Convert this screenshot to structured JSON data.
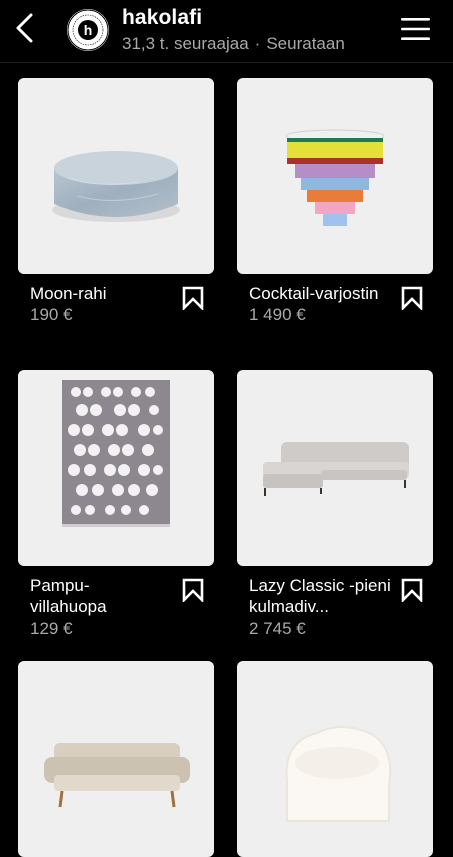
{
  "header": {
    "account_name": "hakolafi",
    "followers": "31,3 t. seuraajaa",
    "separator": "·",
    "follow_state": "Seurataan",
    "avatar_letter": "h",
    "avatar_ring_text": "made in finland · hakola since 1960"
  },
  "products": [
    {
      "name": "Moon-rahi",
      "price": "190 €",
      "icon": "marble-pouf"
    },
    {
      "name": "Cocktail-varjostin",
      "price": "1 490 €",
      "icon": "chandelier"
    },
    {
      "name": "Pampu-villahuopa",
      "price": "129 €",
      "icon": "wool-blanket"
    },
    {
      "name": "Lazy Classic -pieni kulmadiv...",
      "price": "2 745 €",
      "icon": "corner-sofa"
    },
    {
      "name": "",
      "price": "",
      "icon": "beige-sofa"
    },
    {
      "name": "",
      "price": "",
      "icon": "armchair"
    }
  ],
  "colors": {
    "background": "#000000",
    "thumb_bg": "#efefef",
    "secondary_text": "#a9a9a9"
  }
}
